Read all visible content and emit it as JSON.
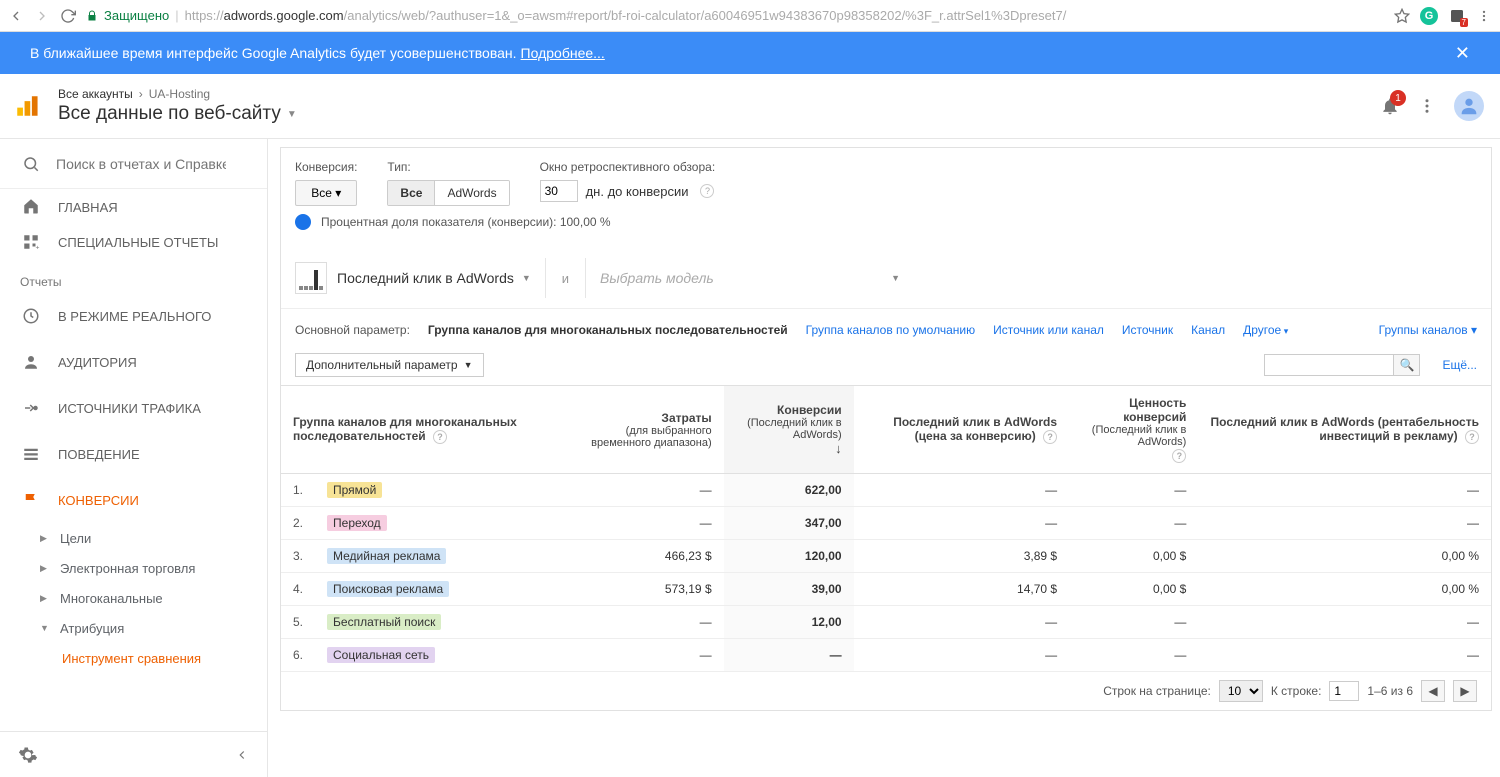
{
  "browser": {
    "secure_label": "Защищено",
    "url_domain": "adwords.google.com",
    "url_path": "/analytics/web/?authuser=1&_o=awsm#report/bf-roi-calculator/a60046951w94383670p98358202/%3F_r.attrSel1%3Dpreset7/",
    "ext_badge": "7"
  },
  "banner": {
    "text": "В ближайшее время интерфейс Google Analytics будет усовершенствован.",
    "link": "Подробнее..."
  },
  "header": {
    "crumb1": "Все аккаунты",
    "crumb2": "UA-Hosting",
    "view_title": "Все данные по веб-сайту",
    "notif_count": "1"
  },
  "sidebar": {
    "search_placeholder": "Поиск в отчетах и Справке",
    "items": [
      {
        "label": "ГЛАВНАЯ"
      },
      {
        "label": "СПЕЦИАЛЬНЫЕ ОТЧЕТЫ"
      }
    ],
    "section": "Отчеты",
    "reports": [
      {
        "label": "В РЕЖИМЕ РЕАЛЬНОГО"
      },
      {
        "label": "АУДИТОРИЯ"
      },
      {
        "label": "ИСТОЧНИКИ ТРАФИКА"
      },
      {
        "label": "ПОВЕДЕНИЕ"
      },
      {
        "label": "КОНВЕРСИИ"
      }
    ],
    "subs": [
      {
        "label": "Цели"
      },
      {
        "label": "Электронная торговля"
      },
      {
        "label": "Многоканальные"
      },
      {
        "label": "Атрибуция"
      }
    ],
    "sub_selected": "Инструмент сравнения"
  },
  "filters": {
    "conv_label": "Конверсия:",
    "conv_value": "Все",
    "type_label": "Тип:",
    "type_opt1": "Все",
    "type_opt2": "AdWords",
    "lookback_label": "Окно ретроспективного обзора:",
    "lookback_days": "30",
    "lookback_suffix": "дн. до конверсии",
    "pct_text": "Процентная доля показателя (конверсии): 100,00 %"
  },
  "model": {
    "name": "Последний клик в AdWords",
    "sep": "и",
    "placeholder": "Выбрать модель"
  },
  "params": {
    "label": "Основной параметр:",
    "tabs": [
      "Группа каналов для многоканальных последовательностей",
      "Группа каналов по умолчанию",
      "Источник или канал",
      "Источник",
      "Канал",
      "Другое"
    ],
    "group_dd": "Группы каналов"
  },
  "secondary": {
    "dd_label": "Дополнительный параметр",
    "more": "Ещё..."
  },
  "table": {
    "col0": "Группа каналов для многоканальных последовательностей",
    "col1_a": "Затраты",
    "col1_b": "(для выбранного временного диапазона)",
    "col2_a": "Конверсии",
    "col2_b": "(Последний клик в AdWords)",
    "col3_a": "Последний клик в AdWords (цена за конверсию)",
    "col4_a": "Ценность конверсий",
    "col4_b": "(Последний клик в AdWords)",
    "col5_a": "Последний клик в AdWords (рентабельность инвестиций в рекламу)",
    "rows": [
      {
        "n": "1.",
        "name": "Прямой",
        "chip": "#f7e396",
        "cost": "—",
        "conv": "622,00",
        "cpa": "—",
        "val": "—",
        "roi": "—"
      },
      {
        "n": "2.",
        "name": "Переход",
        "chip": "#f6cde0",
        "cost": "—",
        "conv": "347,00",
        "cpa": "—",
        "val": "—",
        "roi": "—"
      },
      {
        "n": "3.",
        "name": "Медийная реклама",
        "chip": "#cfe3f6",
        "cost": "466,23 $",
        "conv": "120,00",
        "cpa": "3,89 $",
        "val": "0,00 $",
        "roi": "0,00 %"
      },
      {
        "n": "4.",
        "name": "Поисковая реклама",
        "chip": "#cfe3f6",
        "cost": "573,19 $",
        "conv": "39,00",
        "cpa": "14,70 $",
        "val": "0,00 $",
        "roi": "0,00 %"
      },
      {
        "n": "5.",
        "name": "Бесплатный поиск",
        "chip": "#d9edc6",
        "cost": "—",
        "conv": "12,00",
        "cpa": "—",
        "val": "—",
        "roi": "—"
      },
      {
        "n": "6.",
        "name": "Социальная сеть",
        "chip": "#e2d3f0",
        "cost": "—",
        "conv": "—",
        "cpa": "—",
        "val": "—",
        "roi": "—"
      }
    ]
  },
  "pager": {
    "rows_label": "Строк на странице:",
    "rows_value": "10",
    "goto_label": "К строке:",
    "goto_value": "1",
    "range": "1–6 из 6"
  }
}
